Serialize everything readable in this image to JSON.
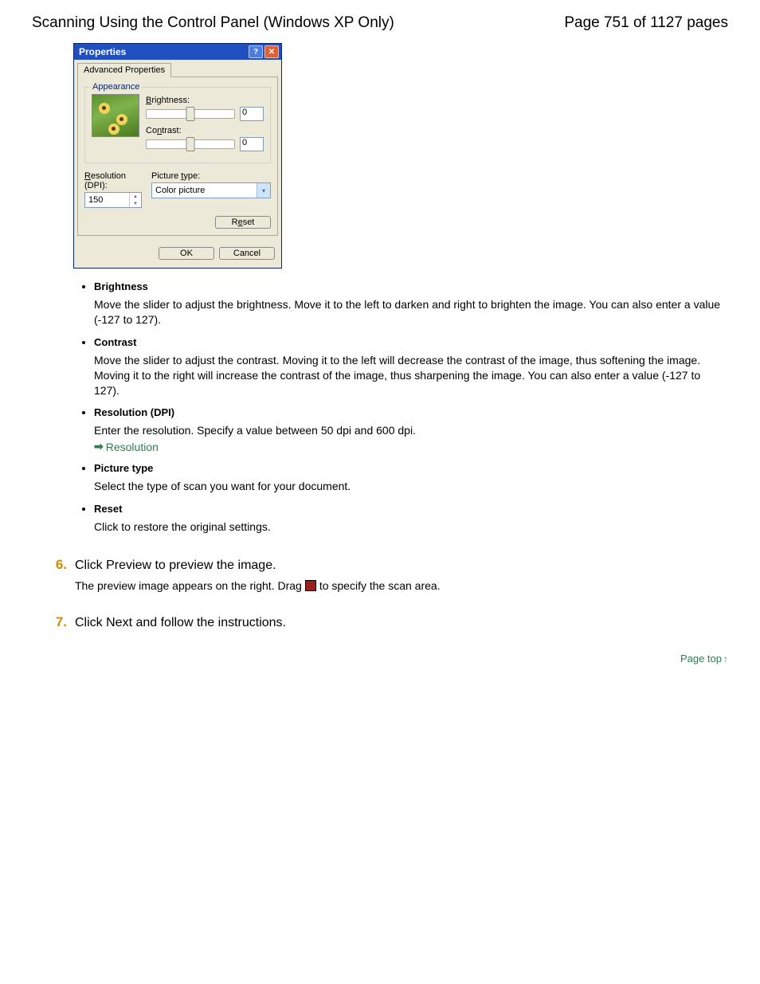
{
  "header": {
    "title": "Scanning Using the Control Panel (Windows XP Only)",
    "page_info": "Page 751 of 1127 pages"
  },
  "dialog": {
    "title": "Properties",
    "tab": "Advanced Properties",
    "group": "Appearance",
    "brightness_label": "Brightness:",
    "brightness_value": "0",
    "contrast_label": "Contrast:",
    "contrast_value": "0",
    "resolution_label": "Resolution (DPI):",
    "resolution_value": "150",
    "picture_type_label": "Picture type:",
    "picture_type_value": "Color picture",
    "reset": "Reset",
    "ok": "OK",
    "cancel": "Cancel"
  },
  "items": {
    "brightness": {
      "term": "Brightness",
      "desc": "Move the slider to adjust the brightness. Move it to the left to darken and right to brighten the image. You can also enter a value (-127 to 127)."
    },
    "contrast": {
      "term": "Contrast",
      "desc": "Move the slider to adjust the contrast. Moving it to the left will decrease the contrast of the image, thus softening the image. Moving it to the right will increase the contrast of the image, thus sharpening the image. You can also enter a value (-127 to 127)."
    },
    "resolution": {
      "term": "Resolution (DPI)",
      "desc": "Enter the resolution. Specify a value between 50 dpi and 600 dpi.",
      "link": "Resolution"
    },
    "picture_type": {
      "term": "Picture type",
      "desc": "Select the type of scan you want for your document."
    },
    "reset": {
      "term": "Reset",
      "desc": "Click to restore the original settings."
    }
  },
  "steps": {
    "s6": {
      "num": "6.",
      "title": "Click Preview to preview the image.",
      "body_pre": "The preview image appears on the right. Drag",
      "body_post": "to specify the scan area."
    },
    "s7": {
      "num": "7.",
      "title": "Click Next and follow the instructions."
    }
  },
  "page_top": "Page top"
}
